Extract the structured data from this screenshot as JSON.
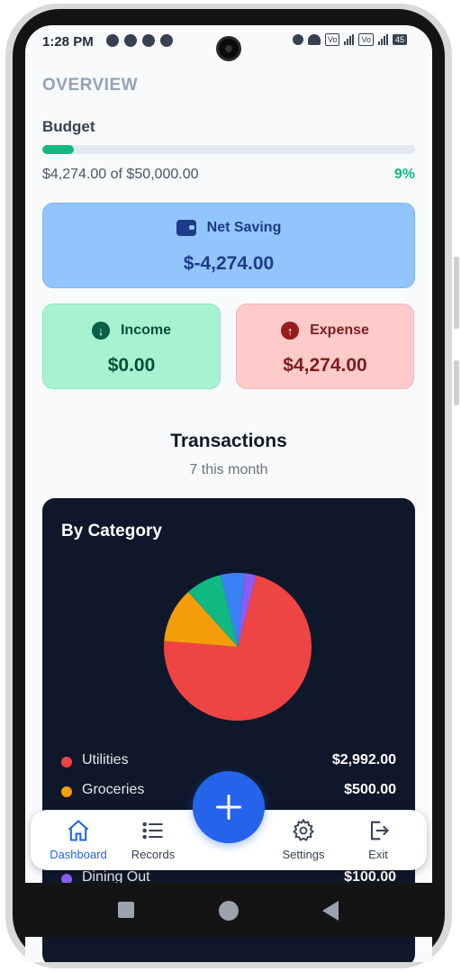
{
  "status_bar": {
    "time": "1:28 PM",
    "battery": "45"
  },
  "overview": {
    "title": "OVERVIEW",
    "budget_label": "Budget",
    "budget_progress": 0.0855,
    "budget_amount": "$4,274.00 of $50,000.00",
    "budget_percent": "9%"
  },
  "cards": {
    "net_saving": {
      "label": "Net Saving",
      "value": "$-4,274.00",
      "icon": "wallet-icon"
    },
    "income": {
      "label": "Income",
      "value": "$0.00",
      "icon": "arrow-down-circle-icon"
    },
    "expense": {
      "label": "Expense",
      "value": "$4,274.00",
      "icon": "arrow-up-circle-icon"
    }
  },
  "transactions": {
    "title": "Transactions",
    "subtitle": "7 this month"
  },
  "category_card": {
    "title": "By Category"
  },
  "chart_data": {
    "type": "pie",
    "title": "By Category",
    "categories": [
      "Utilities",
      "Groceries",
      "",
      "",
      "Dining Out"
    ],
    "values": [
      2992,
      500,
      330,
      220,
      100
    ],
    "colors": [
      "#ef4444",
      "#f59e0b",
      "#10b981",
      "#3b82f6",
      "#8b5cf6"
    ]
  },
  "legend": [
    {
      "name": "Utilities",
      "value": "$2,992.00",
      "color": "#ef4444"
    },
    {
      "name": "Groceries",
      "value": "$500.00",
      "color": "#f59e0b"
    },
    {
      "name": "Dining Out",
      "value": "$100.00",
      "color": "#8b5cf6"
    }
  ],
  "bottom_nav": {
    "items": [
      {
        "label": "Dashboard",
        "icon": "home-icon",
        "active": true
      },
      {
        "label": "Records",
        "icon": "list-icon",
        "active": false
      },
      {
        "label": "Settings",
        "icon": "gear-icon",
        "active": false
      },
      {
        "label": "Exit",
        "icon": "exit-icon",
        "active": false
      }
    ],
    "fab_icon": "plus-icon"
  },
  "colors": {
    "accent": "#2563eb",
    "success": "#10b981",
    "card_dark": "#0f172a"
  }
}
